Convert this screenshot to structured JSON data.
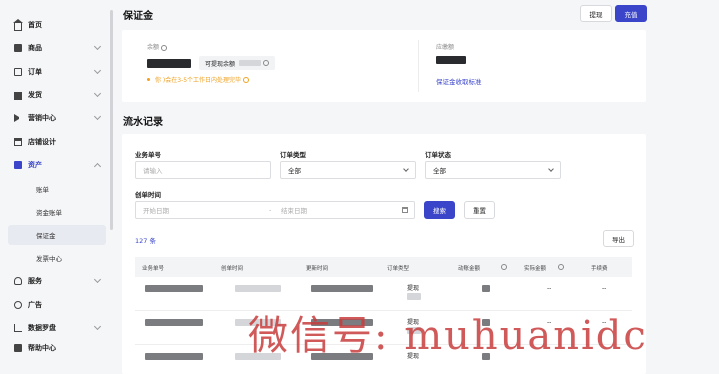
{
  "sidebar": {
    "items": [
      {
        "label": "首页",
        "icon": "home-icon"
      },
      {
        "label": "商品",
        "icon": "box-icon"
      },
      {
        "label": "订单",
        "icon": "order-icon"
      },
      {
        "label": "发货",
        "icon": "truck-icon"
      },
      {
        "label": "营销中心",
        "icon": "megaphone-icon"
      },
      {
        "label": "店铺设计",
        "icon": "shop-icon"
      },
      {
        "label": "资产",
        "icon": "wallet-icon"
      },
      {
        "label": "服务",
        "icon": "service-icon"
      },
      {
        "label": "广告",
        "icon": "ad-icon"
      },
      {
        "label": "数据罗盘",
        "icon": "chart-icon"
      },
      {
        "label": "帮助中心",
        "icon": "help-icon"
      }
    ],
    "sub_items": [
      {
        "label": "账单"
      },
      {
        "label": "资金账单"
      },
      {
        "label": "保证金",
        "active": true
      },
      {
        "label": "发票中心"
      }
    ]
  },
  "header": {
    "title": "保证金",
    "withdraw_label": "提现",
    "recharge_label": "充值"
  },
  "balance_card": {
    "balance_label": "余额",
    "withdrawable_label": "可提现余额",
    "notice": "你 )会在3-5个工作日内处理完毕",
    "payable_label": "应缴额",
    "standard_link": "保证金收取标准"
  },
  "records": {
    "title": "流水记录",
    "filters": {
      "order_no_label": "业务单号",
      "order_no_placeholder": "请输入",
      "order_type_label": "订单类型",
      "order_type_value": "全部",
      "order_status_label": "订单状态",
      "order_status_value": "全部",
      "created_label": "创单时间",
      "start_placeholder": "开始日期",
      "end_placeholder": "结束日期",
      "search_label": "搜索",
      "reset_label": "重置"
    },
    "count_text": "127 条",
    "export_label": "导出",
    "columns": [
      "业务单号",
      "创单时间",
      "更新时间",
      "订单类型",
      "动账金额",
      "实际金额",
      "手续费"
    ],
    "rows": [
      {
        "order_type": "提现",
        "actual": "--",
        "fee": "--"
      },
      {
        "order_type": "提现",
        "actual": "--",
        "fee": "--"
      },
      {
        "order_type": "提现",
        "actual": "",
        "fee": ""
      }
    ]
  },
  "watermark": "微信号: muhuanidc",
  "colors": {
    "accent": "#3a45c9",
    "warning": "#f0a020"
  }
}
